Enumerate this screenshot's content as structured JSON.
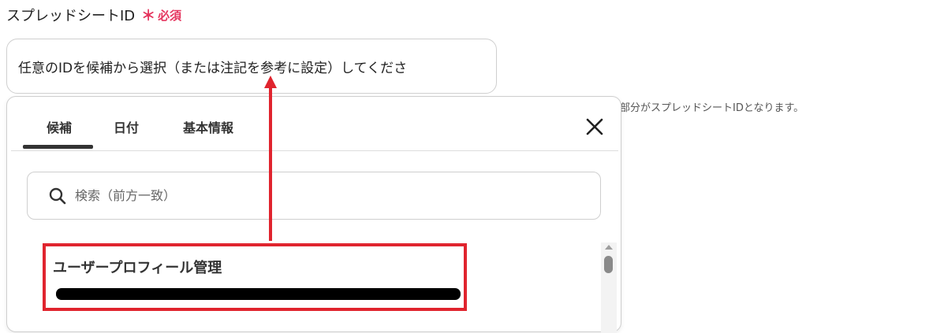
{
  "field": {
    "label": "スプレッドシートID",
    "required_mark": "＊",
    "required_text": "必須",
    "input_value": "任意のIDを候補から選択（または注記を参考に設定）してくださ",
    "help_text": "部分がスプレッドシートIDとなります。"
  },
  "popup": {
    "tabs": [
      {
        "label": "候補",
        "active": true
      },
      {
        "label": "日付",
        "active": false
      },
      {
        "label": "基本情報",
        "active": false
      }
    ],
    "close_icon": "close-icon",
    "search": {
      "placeholder": "検索（前方一致）",
      "icon": "search-icon"
    },
    "candidates": [
      {
        "title": "ユーザープロフィール管理"
      }
    ]
  },
  "colors": {
    "required": "#e5365f",
    "highlight": "#e0242e",
    "text": "#333333",
    "border": "#cfcfcf"
  }
}
